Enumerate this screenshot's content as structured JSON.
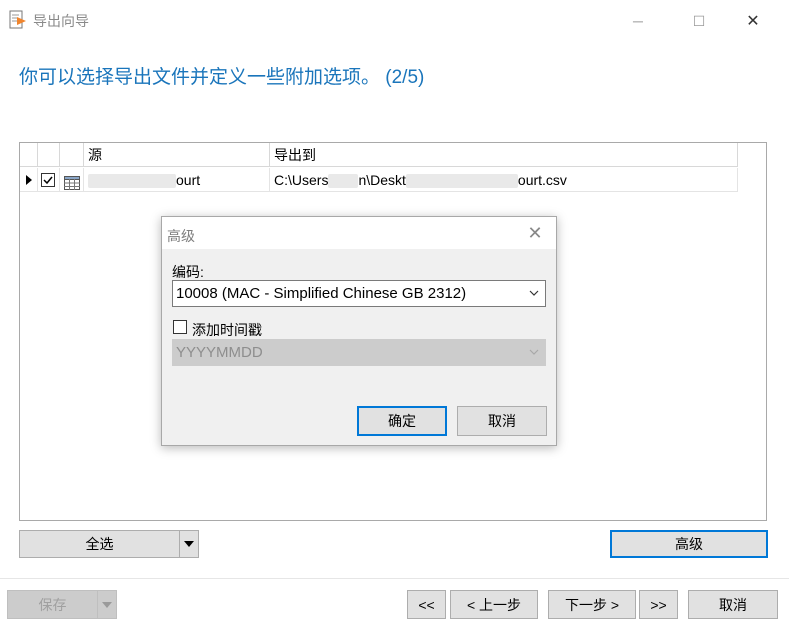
{
  "window": {
    "title": "导出向导",
    "min_glyph": "─",
    "max_glyph": "☐",
    "close_glyph": "✕"
  },
  "heading": "你可以选择导出文件并定义一些附加选项。 (2/5)",
  "table": {
    "columns": [
      "源",
      "导出到"
    ],
    "rows": [
      {
        "checked": true,
        "source_suffix": "ourt",
        "dest_part1": "C:\\Users",
        "dest_part2": "n\\Deskt",
        "dest_suffix": "ourt.csv"
      }
    ]
  },
  "buttons": {
    "select_all": "全选",
    "advanced": "高级",
    "save": "保存",
    "first": "<<",
    "prev": "< 上一步",
    "next": "下一步 >",
    "last": ">>",
    "cancel": "取消"
  },
  "dialog": {
    "title": "高级",
    "close_glyph": "✕",
    "encoding_label": "编码:",
    "encoding_value": "10008 (MAC - Simplified Chinese GB 2312)",
    "timestamp_label": "添加时间戳",
    "timestamp_checked": false,
    "timestamp_format": "YYYYMMDD",
    "ok": "确定",
    "cancel": "取消"
  },
  "colors": {
    "accent": "#0078d7",
    "heading": "#1a75bb",
    "icon_orange": "#f0852d"
  }
}
